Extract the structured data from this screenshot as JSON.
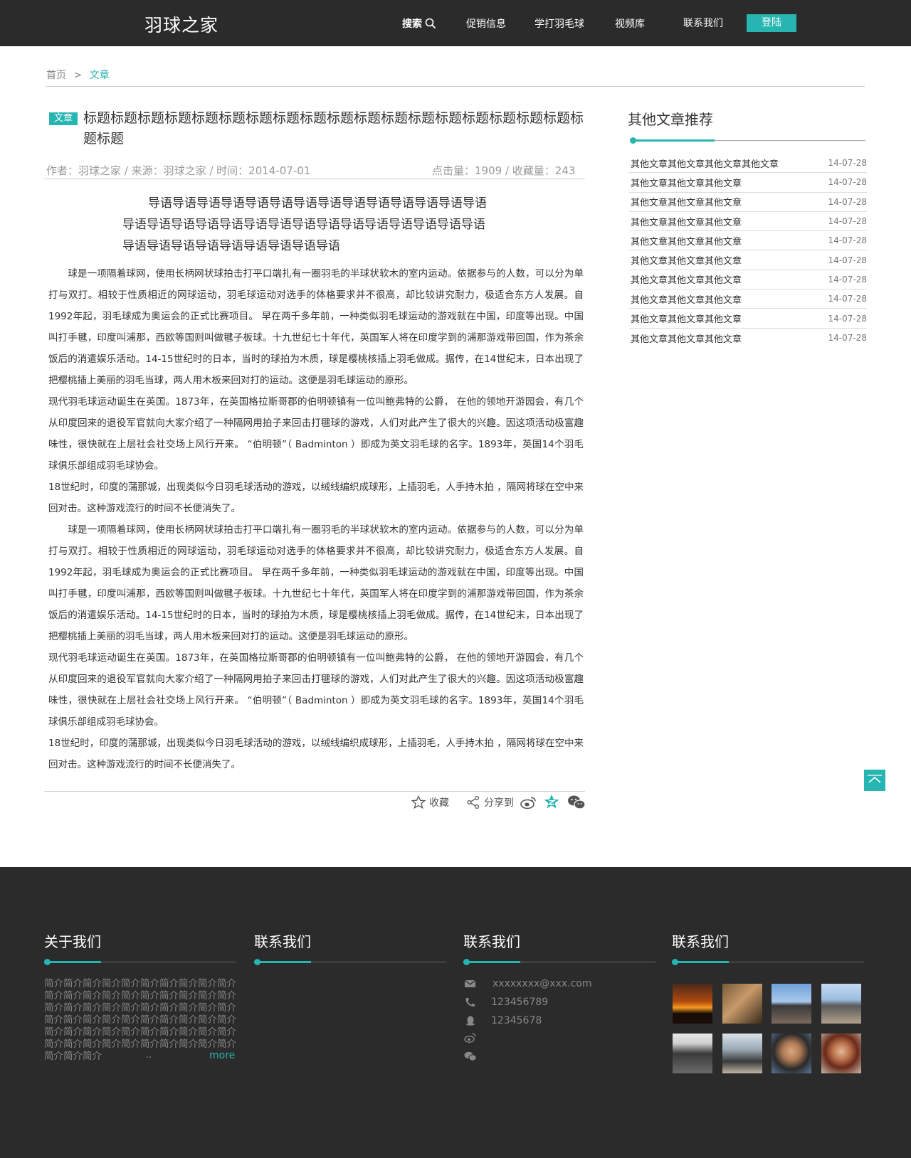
{
  "header": {
    "logo": "羽球之家",
    "nav": [
      "搜索",
      "促销信息",
      "学打羽毛球",
      "视频库",
      "联系我们"
    ],
    "login": "登陆"
  },
  "breadcrumb": {
    "home": "首页",
    "sep": ">",
    "current": "文章"
  },
  "article": {
    "tag": "文章",
    "title": "标题标题标题标题标题标题标题标题标题标题标题标题标题标题标题标题标题标题标题标题",
    "meta_left": "作者：羽球之家 / 来源：羽球之家 / 时间：2014-07-01",
    "meta_right": "点击量：1909 / 收藏量：243",
    "lead": [
      "导语导语导语导语导语导语导语导语导语导语导语导语导语导语",
      "导语导语导语导语导语导语导语导语导语导语导语导语导语导语导语",
      "导语导语导语导语导语导语导语导语导语"
    ],
    "paragraphs": [
      "　　球是一项隔着球网，使用长柄网状球拍击打平口端扎有一圈羽毛的半球状软木的室内运动。依据参与的人数，可以分为单打与双打。相较于性质相近的网球运动，羽毛球运动对选手的体格要求并不很高，却比较讲究耐力，极适合东方人发展。自1992年起，羽毛球成为奥运会的正式比赛项目。 早在两千多年前，一种类似羽毛球运动的游戏就在中国，印度等出现。中国叫打手毽，印度叫浦那，西欧等国则叫做毽子板球。十九世纪七十年代，英国军人将在印度学到的浦那游戏带回国，作为茶余饭后的消遣娱乐活动。14-15世纪时的日本，当时的球拍为木质，球是樱桃核插上羽毛做成。据传，在14世纪末，日本出现了把樱桃插上美丽的羽毛当球，两人用木板来回对打的运动。这便是羽毛球运动的原形。",
      "现代羽毛球运动诞生在英国。1873年，在英国格拉斯哥郡的伯明顿镇有一位叫鲍弗特的公爵， 在他的领地开游园会，有几个从印度回来的退役军官就向大家介绍了一种隔网用拍子来回击打毽球的游戏，人们对此产生了很大的兴趣。因这项活动极富趣味性，很快就在上层社会社交场上风行开来。 “伯明顿”（ Badminton ）即成为英文羽毛球的名字。1893年，英国14个羽毛球俱乐部组成羽毛球协会。",
      "18世纪时，印度的蒲那城，出现类似今日羽毛球活动的游戏，以绒线编织成球形，上插羽毛，人手持木拍 ，隔网将球在空中来回对击。这种游戏流行的时间不长便消失了。",
      "　　球是一项隔着球网，使用长柄网状球拍击打平口端扎有一圈羽毛的半球状软木的室内运动。依据参与的人数，可以分为单打与双打。相较于性质相近的网球运动，羽毛球运动对选手的体格要求并不很高，却比较讲究耐力，极适合东方人发展。自1992年起，羽毛球成为奥运会的正式比赛项目。 早在两千多年前，一种类似羽毛球运动的游戏就在中国，印度等出现。中国叫打手毽，印度叫浦那，西欧等国则叫做毽子板球。十九世纪七十年代，英国军人将在印度学到的浦那游戏带回国，作为茶余饭后的消遣娱乐活动。14-15世纪时的日本，当时的球拍为木质，球是樱桃核插上羽毛做成。据传，在14世纪末，日本出现了把樱桃插上美丽的羽毛当球，两人用木板来回对打的运动。这便是羽毛球运动的原形。",
      "现代羽毛球运动诞生在英国。1873年，在英国格拉斯哥郡的伯明顿镇有一位叫鲍弗特的公爵， 在他的领地开游园会，有几个从印度回来的退役军官就向大家介绍了一种隔网用拍子来回击打毽球的游戏，人们对此产生了很大的兴趣。因这项活动极富趣味性，很快就在上层社会社交场上风行开来。 “伯明顿”（ Badminton ）即成为英文羽毛球的名字。1893年，英国14个羽毛球俱乐部组成羽毛球协会。",
      "18世纪时，印度的蒲那城，出现类似今日羽毛球活动的游戏，以绒线编织成球形，上插羽毛，人手持木拍 ，隔网将球在空中来回对击。这种游戏流行的时间不长便消失了。"
    ],
    "favorite": "收藏",
    "share": "分享到"
  },
  "sidebar": {
    "title": "其他文章推荐",
    "items": [
      {
        "title": "其他文章其他文章其他文章其他文章",
        "date": "14-07-28"
      },
      {
        "title": "其他文章其他文章其他文章",
        "date": "14-07-28"
      },
      {
        "title": "其他文章其他文章其他文章",
        "date": "14-07-28"
      },
      {
        "title": "其他文章其他文章其他文章",
        "date": "14-07-28"
      },
      {
        "title": "其他文章其他文章其他文章",
        "date": "14-07-28"
      },
      {
        "title": "其他文章其他文章其他文章",
        "date": "14-07-28"
      },
      {
        "title": "其他文章其他文章其他文章",
        "date": "14-07-28"
      },
      {
        "title": "其他文章其他文章其他文章",
        "date": "14-07-28"
      },
      {
        "title": "其他文章其他文章其他文章",
        "date": "14-07-28"
      },
      {
        "title": "其他文章其他文章其他文章",
        "date": "14-07-28"
      }
    ]
  },
  "footer": {
    "about_title": "关于我们",
    "contact_title_1": "联系我们",
    "contact_title_2": "联系我们",
    "contact_title_3": "联系我们",
    "intro": "简介简介简介简介简介简介简介简介简介简介简介简介简介简介简介简介简介简介简介简介简介简介简介简介简介简介简介简介简介简介简介简介简介简介简介简介简介简介简介简介简介简介简介简介简介简介简介简介简介简介简介简介简介简介简介简介简介简介简介简介简介简介简介",
    "intro_dots": "..",
    "more": "more",
    "email": "xxxxxxxx@xxx.com",
    "phone": "123456789",
    "qq": "12345678"
  },
  "colors": {
    "accent": "#26b5b0",
    "dark": "#2b2b2b"
  }
}
